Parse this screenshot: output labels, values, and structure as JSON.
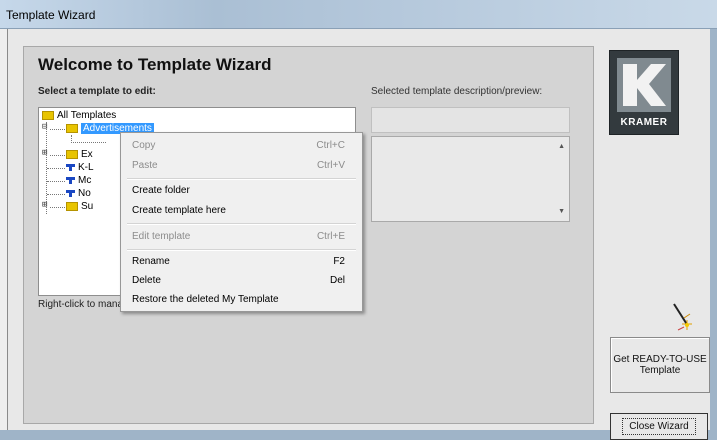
{
  "window": {
    "title": "Template Wizard"
  },
  "heading": "Welcome to Template Wizard",
  "select_label": "Select a template to edit:",
  "preview_label": "Selected template description/preview:",
  "hint": "Right-click to manage a folder or overlay item",
  "tree": {
    "root": "All Templates",
    "selected": "Advertisements",
    "items": [
      {
        "label": "Ex",
        "icon": "folder-icon"
      },
      {
        "label": "K-L",
        "icon": "template-icon"
      },
      {
        "label": "Mc",
        "icon": "template-icon"
      },
      {
        "label": "No",
        "icon": "template-icon"
      },
      {
        "label": "Su",
        "icon": "folder-icon"
      }
    ]
  },
  "logo": {
    "text": "KRAMER"
  },
  "buttons": {
    "get_ready": "Get READY-TO-USE Template",
    "close": "Close Wizard"
  },
  "context_menu": {
    "copy": {
      "label": "Copy",
      "shortcut": "Ctrl+C",
      "enabled": false
    },
    "paste": {
      "label": "Paste",
      "shortcut": "Ctrl+V",
      "enabled": false
    },
    "create_folder": {
      "label": "Create folder",
      "enabled": true
    },
    "create_template": {
      "label": "Create template here",
      "enabled": true
    },
    "edit_template": {
      "label": "Edit template",
      "shortcut": "Ctrl+E",
      "enabled": false
    },
    "rename": {
      "label": "Rename",
      "shortcut": "F2",
      "enabled": true
    },
    "delete": {
      "label": "Delete",
      "shortcut": "Del",
      "enabled": true
    },
    "restore": {
      "label": "Restore the deleted My Template",
      "enabled": true
    }
  },
  "colors": {
    "selection": "#3399ff",
    "folder": "#e8c400",
    "template_icon": "#1a47c2"
  }
}
